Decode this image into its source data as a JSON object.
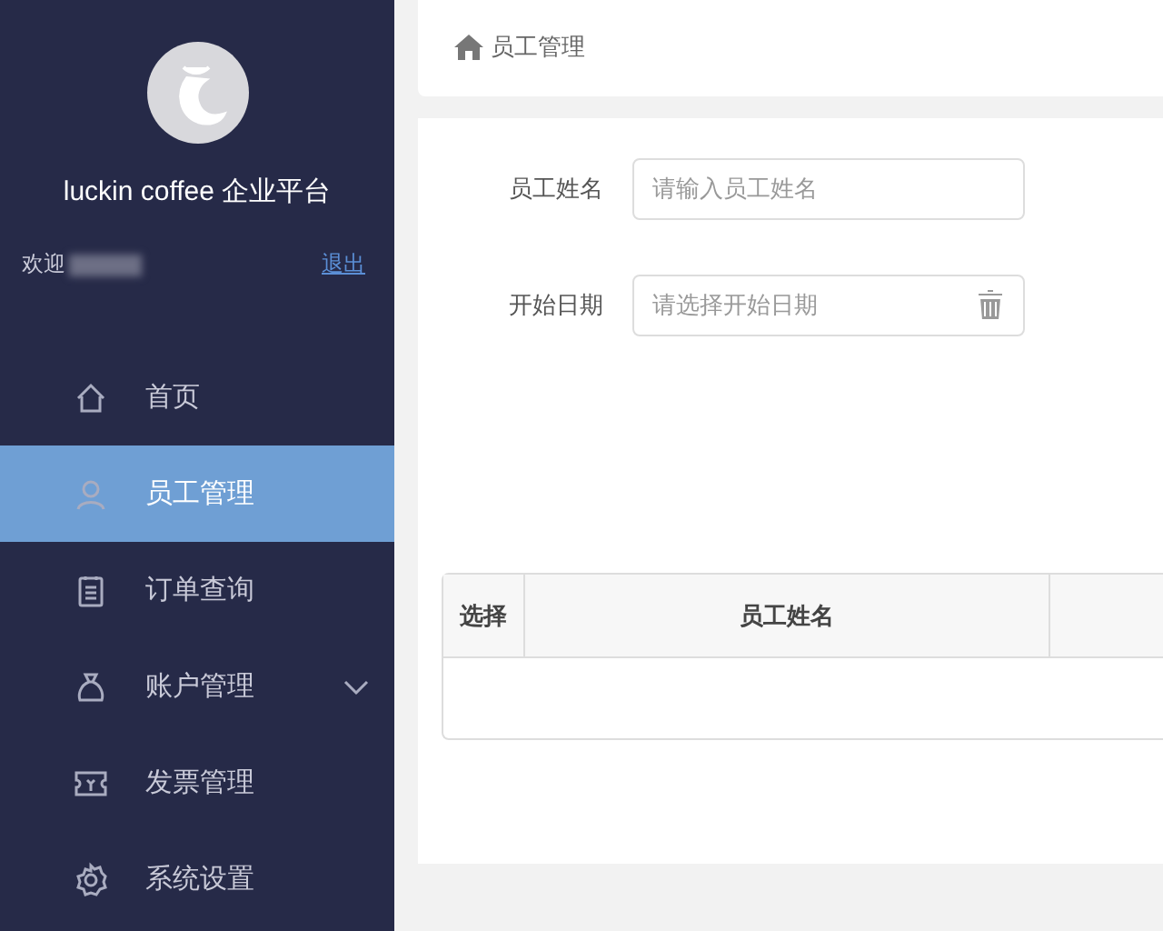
{
  "sidebar": {
    "brand": "luckin coffee 企业平台",
    "welcome": "欢迎",
    "logout": "退出",
    "items": [
      {
        "label": "首页",
        "kind": "home",
        "selected": false,
        "expandable": false
      },
      {
        "label": "员工管理",
        "kind": "user",
        "selected": true,
        "expandable": false
      },
      {
        "label": "订单查询",
        "kind": "list",
        "selected": false,
        "expandable": false
      },
      {
        "label": "账户管理",
        "kind": "bag",
        "selected": false,
        "expandable": true
      },
      {
        "label": "发票管理",
        "kind": "ticket",
        "selected": false,
        "expandable": false
      },
      {
        "label": "系统设置",
        "kind": "gear",
        "selected": false,
        "expandable": false
      }
    ]
  },
  "breadcrumb": "员工管理",
  "form": {
    "fields": [
      {
        "label": "员工姓名",
        "placeholder": "请输入员工姓名",
        "kind": "text"
      },
      {
        "label": "开始日期",
        "placeholder": "请选择开始日期",
        "kind": "date"
      }
    ]
  },
  "table": {
    "columns": [
      "选择",
      "员工姓名"
    ]
  }
}
